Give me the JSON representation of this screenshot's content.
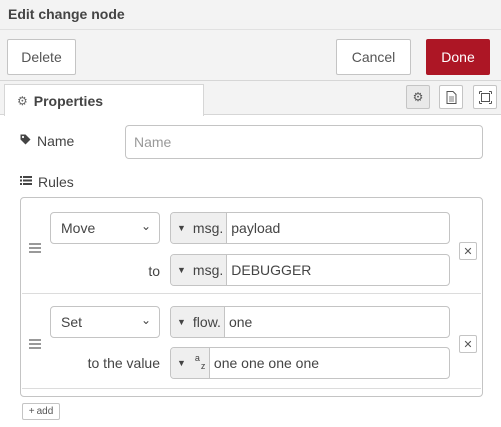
{
  "header": {
    "title": "Edit change node"
  },
  "toolbar": {
    "delete_label": "Delete",
    "cancel_label": "Cancel",
    "done_label": "Done"
  },
  "tabs": [
    {
      "label": "Properties",
      "icon": "cog-icon"
    }
  ],
  "tab_icons": [
    "cog-icon",
    "document-icon",
    "frame-icon"
  ],
  "form": {
    "name_label": "Name",
    "name_placeholder": "Name",
    "name_value": "",
    "rules_label": "Rules"
  },
  "rules": [
    {
      "action": "Move",
      "from": {
        "type": "msg.",
        "value": "payload"
      },
      "to_label": "to",
      "to": {
        "type": "msg.",
        "value": "DEBUGGER"
      }
    },
    {
      "action": "Set",
      "from": {
        "type": "flow.",
        "value": "one"
      },
      "to_label": "to the value",
      "to": {
        "type": "az",
        "value": "one one one one"
      }
    }
  ],
  "add_label": "add",
  "colors": {
    "done_bg": "#ad1625",
    "header_bg": "#f3f3f3",
    "border": "#c4c4c4"
  }
}
